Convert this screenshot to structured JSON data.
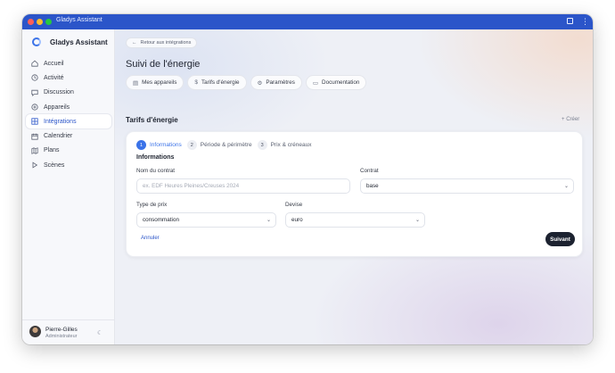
{
  "window": {
    "title": "Gladys Assistant"
  },
  "sidebar": {
    "brand": "Gladys Assistant",
    "items": [
      {
        "label": "Accueil",
        "icon": "home-icon"
      },
      {
        "label": "Activité",
        "icon": "clock-icon"
      },
      {
        "label": "Discussion",
        "icon": "chat-icon"
      },
      {
        "label": "Appareils",
        "icon": "devices-icon"
      },
      {
        "label": "Intégrations",
        "icon": "grid-icon",
        "active": true
      },
      {
        "label": "Calendrier",
        "icon": "calendar-icon"
      },
      {
        "label": "Plans",
        "icon": "map-icon"
      },
      {
        "label": "Scènes",
        "icon": "play-icon"
      }
    ],
    "user": {
      "name": "Pierre-Gilles",
      "role": "Administrateur"
    }
  },
  "header": {
    "back_label": "Retour aux intégrations",
    "title": "Suivi de l'énergie",
    "tabs": [
      {
        "label": "Mes appareils",
        "icon": "list-icon"
      },
      {
        "label": "Tarifs d'énergie",
        "icon": "dollar-icon"
      },
      {
        "label": "Paramètres",
        "icon": "gear-icon"
      },
      {
        "label": "Documentation",
        "icon": "book-icon"
      }
    ]
  },
  "section": {
    "title": "Tarifs d'énergie",
    "create_label": "Créer"
  },
  "wizard": {
    "steps": [
      {
        "num": "1",
        "label": "Informations",
        "active": true
      },
      {
        "num": "2",
        "label": "Période & périmètre"
      },
      {
        "num": "3",
        "label": "Prix & créneaux"
      }
    ],
    "form_title": "Informations",
    "contract_name": {
      "label": "Nom du contrat",
      "placeholder": "ex. EDF Heures Pleines/Creuses 2024",
      "value": ""
    },
    "contract": {
      "label": "Contrat",
      "value": "base"
    },
    "price_type": {
      "label": "Type de prix",
      "value": "consommation"
    },
    "currency": {
      "label": "Devise",
      "value": "euro"
    },
    "cancel_label": "Annuler",
    "next_label": "Suivant"
  },
  "colors": {
    "accent": "#2b55c9",
    "step_active": "#3b73e8",
    "primary_button": "#1c2230"
  }
}
